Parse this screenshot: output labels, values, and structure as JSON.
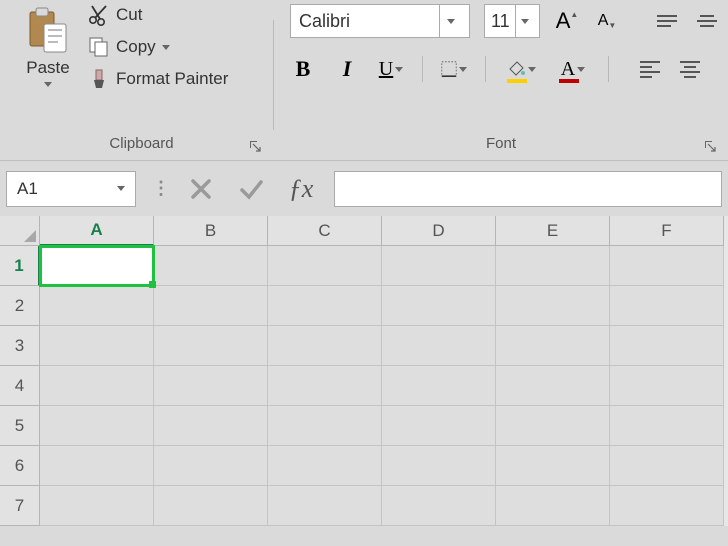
{
  "ribbon": {
    "clipboard": {
      "label": "Clipboard",
      "paste": "Paste",
      "cut": "Cut",
      "copy": "Copy",
      "format_painter": "Format Painter"
    },
    "font": {
      "label": "Font",
      "name": "Calibri",
      "size": "11",
      "bold": "B",
      "italic": "I",
      "underline": "U",
      "grow": "A",
      "shrink": "A",
      "font_color": "#c00000",
      "fill_color": "#ffd000"
    }
  },
  "formula_bar": {
    "name_box": "A1",
    "formula": ""
  },
  "grid": {
    "columns": [
      "A",
      "B",
      "C",
      "D",
      "E",
      "F"
    ],
    "rows": [
      "1",
      "2",
      "3",
      "4",
      "5",
      "6",
      "7"
    ],
    "active_cell": "A1"
  }
}
